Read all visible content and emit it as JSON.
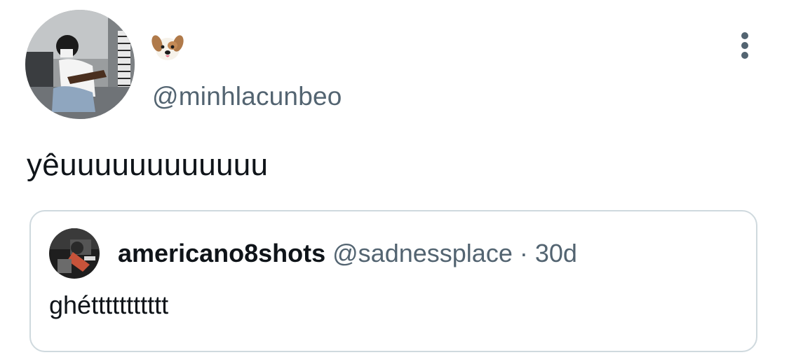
{
  "tweet": {
    "display_name_icon": "dog-face-icon",
    "handle": "@minhlacunbeo",
    "text": "yêuuuuuuuuuuuu",
    "more_icon": "more-vertical-icon"
  },
  "quoted_tweet": {
    "display_name": "americano8shots",
    "handle": "@sadnessplace",
    "separator": "·",
    "time": "30d",
    "text": "ghéttttttttttt"
  }
}
